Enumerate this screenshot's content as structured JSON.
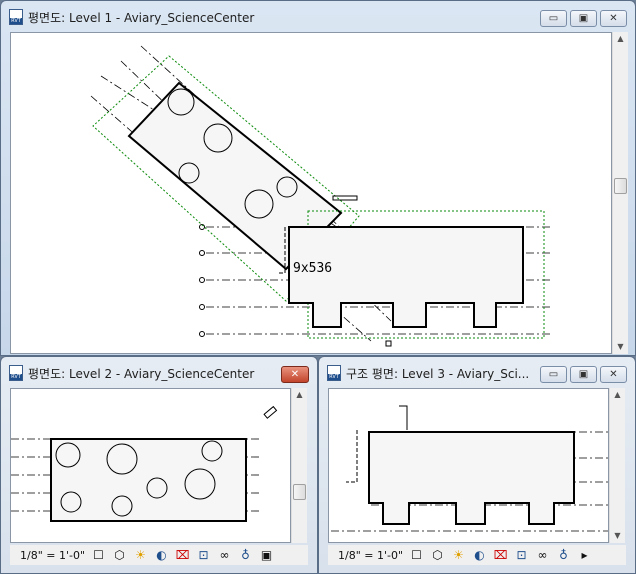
{
  "windows": [
    {
      "title": "평면도: Level 1 - Aviary_ScienceCenter",
      "active": true
    },
    {
      "title": "평면도: Level 2 - Aviary_ScienceCenter",
      "active": false
    },
    {
      "title": "구조 평면: Level 3 - Aviary_Sci...",
      "active": false
    }
  ],
  "controls": {
    "minimize": "▭",
    "restore": "▣",
    "close": "✕"
  },
  "drawing": {
    "tag_text": "9x536"
  },
  "status": {
    "scale": "1/8\" = 1'-0\"",
    "icons": [
      "detail-level-icon",
      "visual-style-icon",
      "sun-path-off-icon",
      "shadows-off-icon",
      "crop-view-icon",
      "show-crop-region-icon",
      "temporary-hide-icon",
      "reveal-hidden-icon",
      "temporary-view-properties-icon"
    ]
  },
  "colors": {
    "accent": "#1e4e8c",
    "close_active": "#c2452c",
    "crop_region": "#0a8a0a"
  }
}
